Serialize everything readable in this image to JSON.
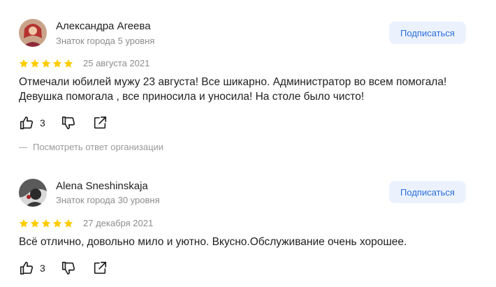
{
  "reviews": [
    {
      "author": "Александра Агеева",
      "level": "Знаток города 5 уровня",
      "subscribe_label": "Подписаться",
      "rating": 5,
      "date": "25 августа 2021",
      "text": "Отмечали юбилей мужу 23 августа! Все шикарно. Администратор во всем помогала! Девушка помогала , все приносила и уносила! На столе было чисто!",
      "likes": "3",
      "org_reply_label": "Посмотреть ответ организации"
    },
    {
      "author": "Alena Sneshinskaja",
      "level": "Знаток города 30 уровня",
      "subscribe_label": "Подписаться",
      "rating": 5,
      "date": "27 декабря 2021",
      "text": "Всё отлично, довольно мило и уютно. Вкусно.Обслуживание очень хорошее.",
      "likes": "3"
    }
  ],
  "colors": {
    "star": "#fc0",
    "subscribe_bg": "#ecf2fd",
    "subscribe_text": "#2a6ed8",
    "muted_text": "#8c8c8c"
  },
  "icons": {
    "like": "thumbs-up-icon",
    "dislike": "thumbs-down-icon",
    "share": "share-icon",
    "star": "star-icon"
  }
}
